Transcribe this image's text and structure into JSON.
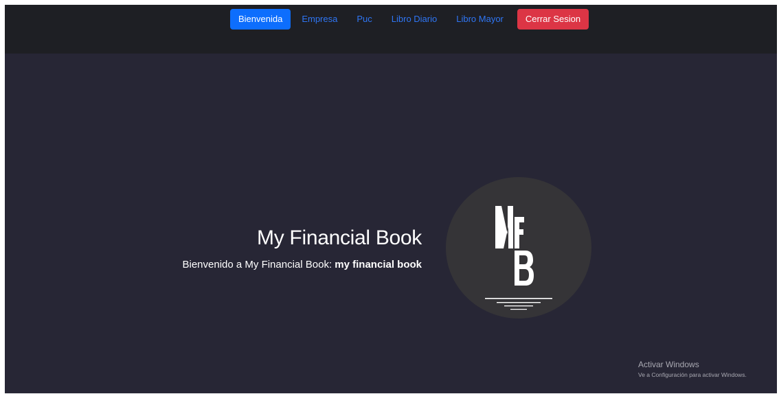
{
  "nav": {
    "items": [
      {
        "label": "Bienvenida",
        "state": "active"
      },
      {
        "label": "Empresa",
        "state": "link"
      },
      {
        "label": "Puc",
        "state": "link"
      },
      {
        "label": "Libro Diario",
        "state": "link"
      },
      {
        "label": "Libro Mayor",
        "state": "link"
      },
      {
        "label": "Cerrar Sesion",
        "state": "danger"
      }
    ]
  },
  "hero": {
    "title": "My Financial Book",
    "subtitle_prefix": "Bienvenido a My Financial Book: ",
    "subtitle_bold": "my financial book"
  },
  "logo": {
    "text": "MFB",
    "icon": "mfb-logo-icon"
  },
  "watermark": {
    "title": "Activar Windows",
    "subtitle": "Ve a Configuración para activar Windows."
  },
  "colors": {
    "page_bg": "#272635",
    "navbar_bg": "#1e1f24",
    "primary": "#0d6efd",
    "danger": "#dc3545",
    "link": "#2f76f5",
    "logo_bg": "#353437"
  }
}
